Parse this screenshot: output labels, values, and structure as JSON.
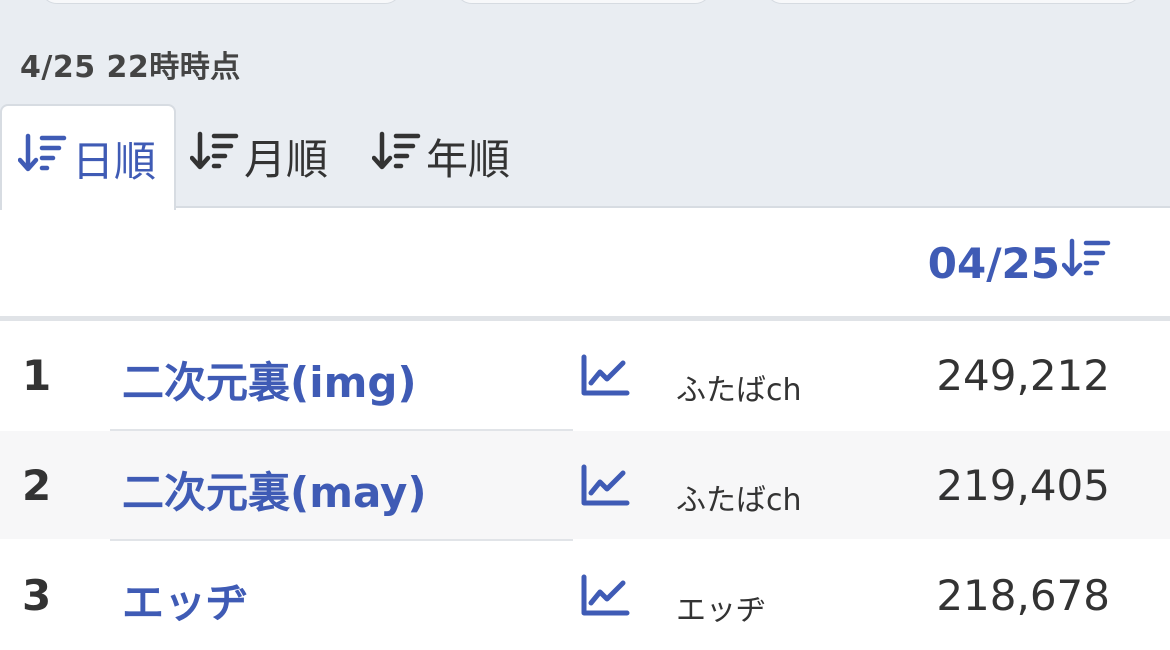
{
  "timestamp": "4/25 22時時点",
  "tabs": [
    {
      "label": "日順",
      "active": true
    },
    {
      "label": "月順",
      "active": false
    },
    {
      "label": "年順",
      "active": false
    }
  ],
  "table": {
    "column_header": "04/25",
    "rows": [
      {
        "rank": "1",
        "name": "二次元裏(img)",
        "site": "ふたばch",
        "count": "249,212"
      },
      {
        "rank": "2",
        "name": "二次元裏(may)",
        "site": "ふたばch",
        "count": "219,405"
      },
      {
        "rank": "3",
        "name": "エッヂ",
        "site": "エッヂ",
        "count": "218,678"
      }
    ]
  },
  "colors": {
    "accent": "#3f5bb5",
    "text": "#333333",
    "page_bg": "#e9edf2"
  },
  "icons": {
    "sort": "sort-descending-icon",
    "trend": "line-chart-icon"
  }
}
